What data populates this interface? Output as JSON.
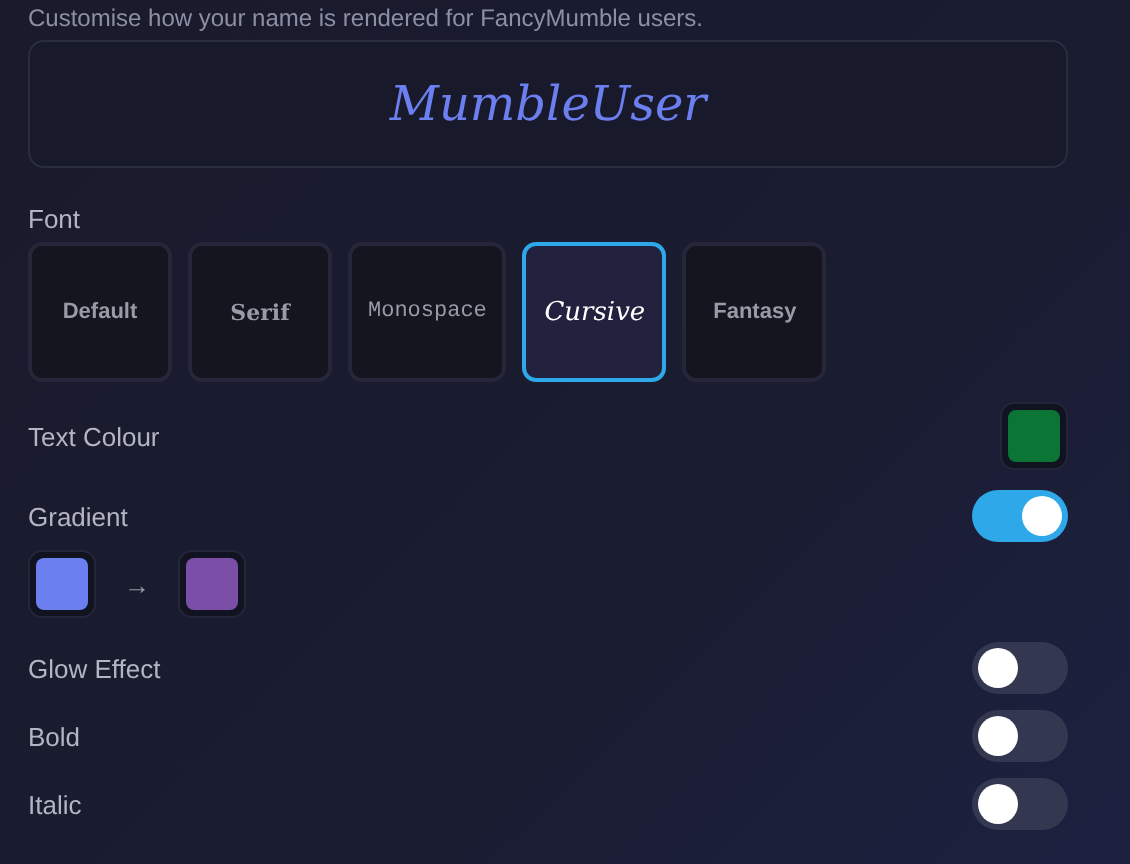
{
  "description": "Customise how your name is rendered for FancyMumble users.",
  "preview": {
    "name": "MumbleUser"
  },
  "font": {
    "label": "Font",
    "options": [
      {
        "label": "Default",
        "kind": "default",
        "selected": false
      },
      {
        "label": "Serif",
        "kind": "serif",
        "selected": false
      },
      {
        "label": "Monospace",
        "kind": "monospace",
        "selected": false
      },
      {
        "label": "Cursive",
        "kind": "cursive",
        "selected": true
      },
      {
        "label": "Fantasy",
        "kind": "fantasy",
        "selected": false
      }
    ]
  },
  "text_colour": {
    "label": "Text Colour",
    "color": "#0b7535"
  },
  "gradient": {
    "label": "Gradient",
    "on": true,
    "stops": [
      {
        "color": "#6b7ff0"
      },
      {
        "color": "#7b4fa8"
      }
    ],
    "arrow": "→"
  },
  "toggles": [
    {
      "label": "Glow Effect",
      "on": false
    },
    {
      "label": "Bold",
      "on": false
    },
    {
      "label": "Italic",
      "on": false
    }
  ]
}
